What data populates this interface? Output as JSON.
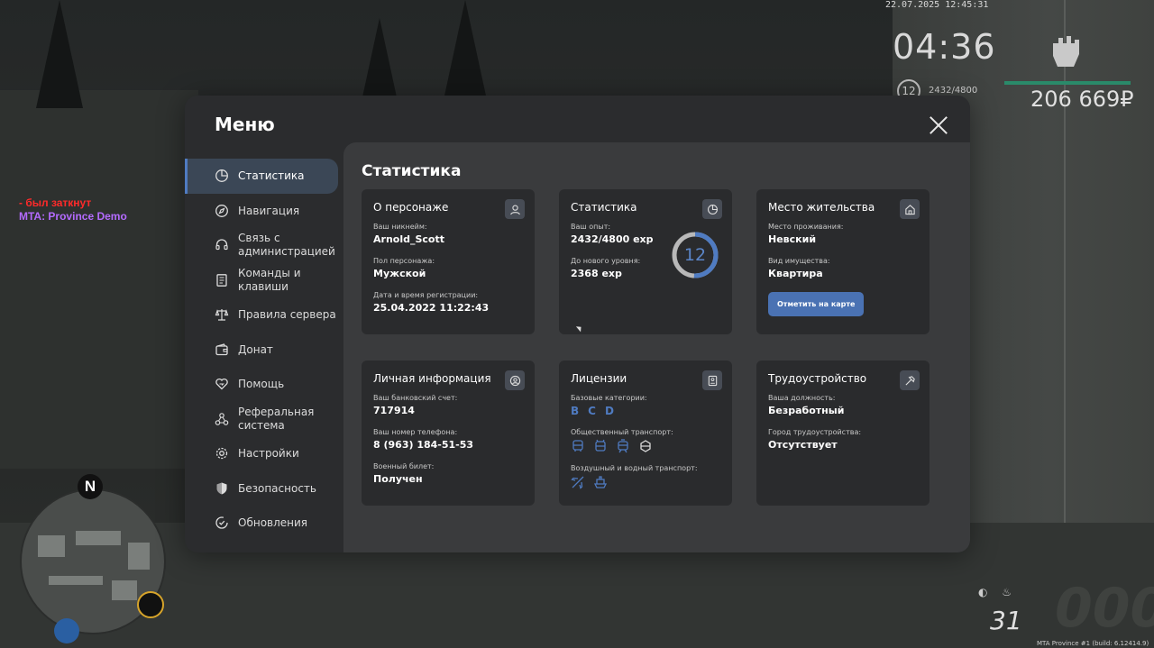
{
  "hud": {
    "datetime": "22.07.2025 12:45:31",
    "time": "04:36",
    "level": "12",
    "exp": "2432/4800",
    "money": "206 669₽",
    "fuel": "31",
    "build": "MTA Province #1 (build: 6.12414.9)"
  },
  "chat": {
    "line1": "- был заткнут",
    "line2": "MTA: Province Demo"
  },
  "minimap": {
    "compass": "N"
  },
  "menu": {
    "title": "Меню",
    "sidebar": [
      {
        "label": "Статистика",
        "icon": "pie-chart-icon"
      },
      {
        "label": "Навигация",
        "icon": "compass-icon"
      },
      {
        "label": "Связь с администрацией",
        "icon": "headset-icon"
      },
      {
        "label": "Команды и клавиши",
        "icon": "document-icon"
      },
      {
        "label": "Правила сервера",
        "icon": "scales-icon"
      },
      {
        "label": "Донат",
        "icon": "wallet-icon"
      },
      {
        "label": "Помощь",
        "icon": "heart-hand-icon"
      },
      {
        "label": "Реферальная система",
        "icon": "network-icon"
      },
      {
        "label": "Настройки",
        "icon": "gear-icon"
      },
      {
        "label": "Безопасность",
        "icon": "shield-icon"
      },
      {
        "label": "Обновления",
        "icon": "refresh-icon"
      }
    ],
    "content_title": "Статистика",
    "cards": {
      "character": {
        "title": "О персонаже",
        "nickname_label": "Ваш никнейм:",
        "nickname": "Arnold_Scott",
        "gender_label": "Пол персонажа:",
        "gender": "Мужской",
        "reg_label": "Дата и время регистрации:",
        "reg": "25.04.2022 11:22:43"
      },
      "stats": {
        "title": "Статистика",
        "exp_label": "Ваш опыт:",
        "exp": "2432/4800 exp",
        "next_label": "До нового уровня:",
        "next": "2368 exp",
        "level": "12",
        "progress": 0.507
      },
      "residence": {
        "title": "Место жительства",
        "place_label": "Место проживания:",
        "place": "Невский",
        "type_label": "Вид имущества:",
        "type": "Квартира",
        "button": "Отметить на карте"
      },
      "personal": {
        "title": "Личная информация",
        "bank_label": "Ваш банковский счет:",
        "bank": "717914",
        "phone_label": "Ваш номер телефона:",
        "phone": "8 (963) 184-51-53",
        "military_label": "Военный билет:",
        "military": "Получен"
      },
      "licenses": {
        "title": "Лицензии",
        "base_label": "Базовые категории:",
        "categories": [
          "B",
          "C",
          "D"
        ],
        "public_label": "Общественный транспорт:",
        "air_label": "Воздушный и водный транспорт:"
      },
      "job": {
        "title": "Трудоустройство",
        "position_label": "Ваша должность:",
        "position": "Безработный",
        "city_label": "Город трудоустройства:",
        "city": "Отсутствует"
      }
    }
  },
  "colors": {
    "accent": "#4f7bc1",
    "panel": "#2b2c2e",
    "content": "#3a3b3d",
    "card": "#2a2b2d"
  }
}
